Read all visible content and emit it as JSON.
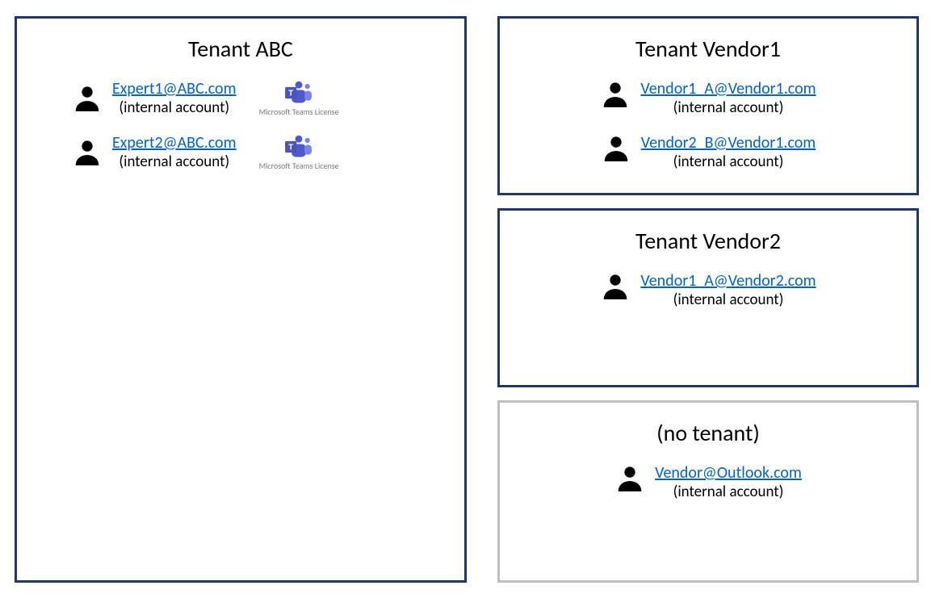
{
  "tenants": {
    "abc": {
      "title": "Tenant ABC",
      "teams_label": "Microsoft Teams License",
      "users": [
        {
          "email": "Expert1@ABC.com",
          "note": "(internal account)",
          "has_teams": true
        },
        {
          "email": "Expert2@ABC.com",
          "note": "(internal account)",
          "has_teams": true
        }
      ]
    },
    "vendor1": {
      "title": "Tenant Vendor1",
      "users": [
        {
          "email": "Vendor1_A@Vendor1.com",
          "note": "(internal account)"
        },
        {
          "email": "Vendor2_B@Vendor1.com",
          "note": "(internal account)"
        }
      ]
    },
    "vendor2": {
      "title": "Tenant Vendor2",
      "users": [
        {
          "email": "Vendor1_A@Vendor2.com",
          "note": "(internal account)"
        }
      ]
    },
    "notenant": {
      "title": "(no tenant)",
      "users": [
        {
          "email": "Vendor@Outlook.com",
          "note": "(internal account)"
        }
      ]
    }
  }
}
